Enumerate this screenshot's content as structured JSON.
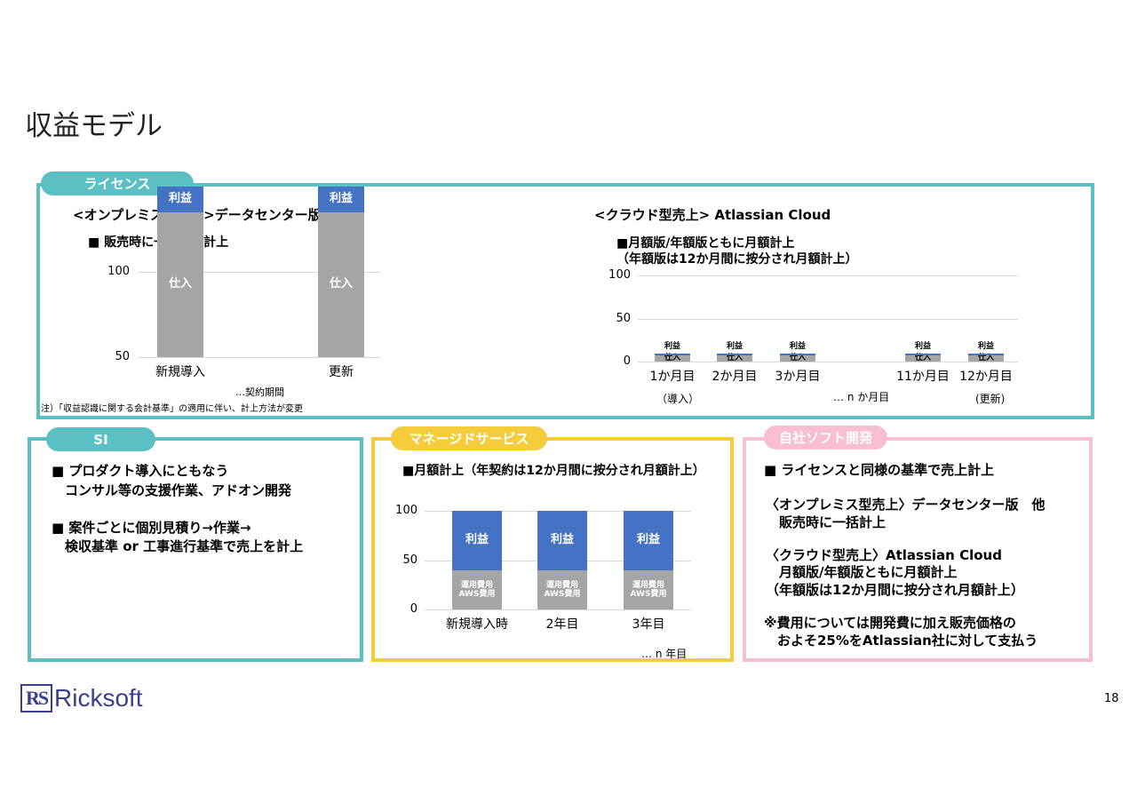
{
  "page": {
    "title": "収益モデル",
    "page_number": "18"
  },
  "license": {
    "label": "ライセンス",
    "onprem": {
      "heading": "<オンプレミス型売上>データセンター版　他",
      "bullet": "■ 販売時に一括売上計上",
      "note_period": "…契約期間",
      "footnote": "注）「収益認識に関する会計基準」の適用に伴い、計上方法が変更"
    },
    "cloud": {
      "heading": "<クラウド型売上> Atlassian Cloud",
      "bullet1": "■月額版/年額版ともに月額計上",
      "bullet2": "（年額版は12か月間に按分され月額計上）",
      "note_n": "… n か月目",
      "sub_first": "（導入）",
      "sub_last": "(更新)"
    }
  },
  "si": {
    "label": "SI",
    "line1": "■ プロダクト導入にともなう",
    "line2": "　コンサル等の支援作業、アドオン開発",
    "line3": "■ 案件ごとに個別見積り→作業→",
    "line4": "　検収基準 or 工事進行基準で売上を計上"
  },
  "managed": {
    "label": "マネージドサービス",
    "bullet": "■月額計上（年契約は12か月間に按分され月額計上）",
    "note_n": "… n 年目"
  },
  "soft": {
    "label": "自社ソフト開発",
    "line1": "■ ライセンスと同様の基準で売上計上",
    "line2": "〈オンプレミス型売上〉データセンター版　他",
    "line3": "　販売時に一括計上",
    "line4": "〈クラウド型売上〉Atlassian Cloud",
    "line5": "　月額版/年額版ともに月額計上",
    "line6": "（年額版は12か月間に按分され月額計上）",
    "line7": "※費用については開発費に加え販売価格の",
    "line8": "　およそ25%をAtlassian社に対して支払う"
  },
  "logo": {
    "text": "Ricksoft",
    "mark": "RS"
  },
  "chart_data": [
    {
      "type": "bar",
      "stacked": true,
      "categories": [
        "新規導入",
        "更新"
      ],
      "series": [
        {
          "name": "仕入",
          "values": [
            85,
            85
          ],
          "color": "#a5a5a5"
        },
        {
          "name": "利益",
          "values": [
            15,
            15
          ],
          "color": "#4472c4"
        }
      ],
      "ylim": [
        50,
        100
      ],
      "yticks": [
        "50",
        "100"
      ]
    },
    {
      "type": "bar",
      "stacked": true,
      "categories": [
        "1か月目",
        "2か月目",
        "3か月目",
        "11か月目",
        "12か月目"
      ],
      "series": [
        {
          "name": "仕入",
          "values": [
            7,
            7,
            7,
            7,
            7
          ],
          "color": "#a5a5a5"
        },
        {
          "name": "利益",
          "values": [
            2,
            2,
            2,
            2,
            2
          ],
          "color": "#4472c4"
        }
      ],
      "ylim": [
        0,
        100
      ],
      "yticks": [
        "0",
        "50",
        "100"
      ]
    },
    {
      "type": "bar",
      "stacked": true,
      "categories": [
        "新規導入時",
        "2年目",
        "3年目"
      ],
      "series": [
        {
          "name": "運用費用\nAWS費用",
          "values": [
            40,
            40,
            40
          ],
          "color": "#a5a5a5"
        },
        {
          "name": "利益",
          "values": [
            60,
            60,
            60
          ],
          "color": "#4472c4"
        }
      ],
      "ylim": [
        0,
        100
      ],
      "yticks": [
        "0",
        "50",
        "100"
      ]
    }
  ]
}
